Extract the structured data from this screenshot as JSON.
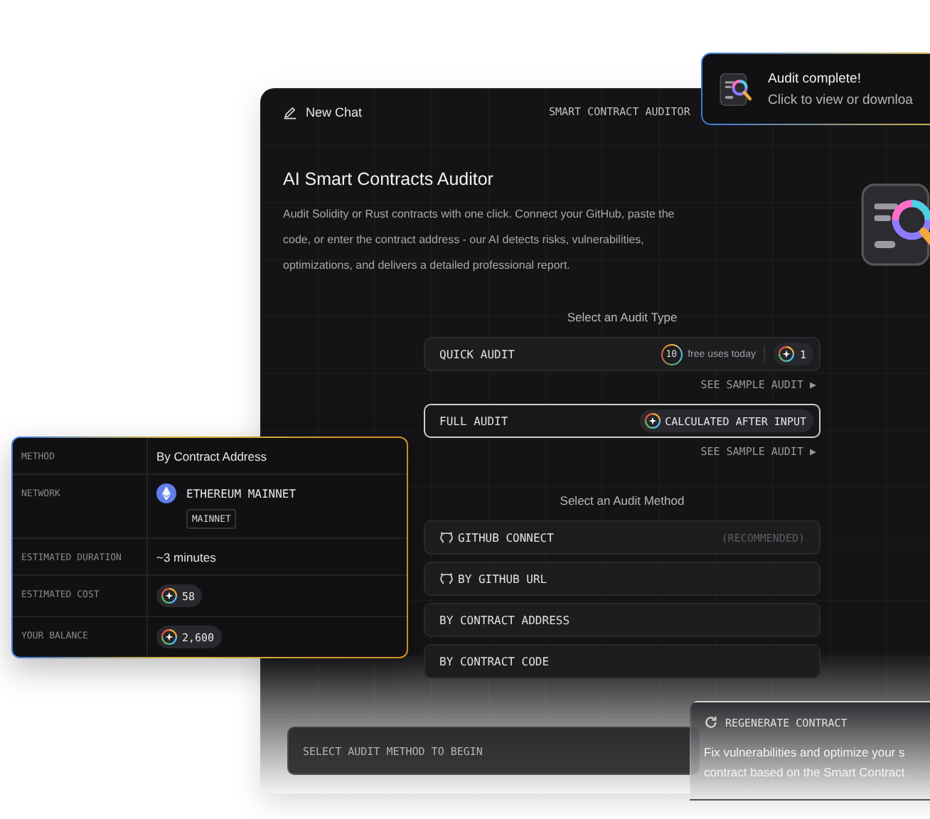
{
  "toast": {
    "title": "Audit complete!",
    "message": "Click to view or downloa"
  },
  "header": {
    "new_chat": "New Chat",
    "title": "SMART CONTRACT AUDITOR"
  },
  "intro": {
    "heading": "AI Smart Contracts Auditor",
    "description": "Audit Solidity or Rust contracts with one click. Connect your GitHub, paste the code, or enter the contract address - our AI detects risks, vulnerabilities, optimizations, and delivers a detailed professional report."
  },
  "audit_types": {
    "heading": "Select an Audit Type",
    "options": [
      {
        "label": "QUICK AUDIT",
        "selected": false,
        "kind": "free",
        "free_count": "10",
        "free_text": "free uses today",
        "cost": "1",
        "sample_link": "SEE SAMPLE AUDIT ▶"
      },
      {
        "label": "FULL AUDIT",
        "selected": true,
        "kind": "calculated",
        "cost": "CALCULATED AFTER INPUT",
        "sample_link": "SEE SAMPLE AUDIT ▶"
      }
    ]
  },
  "audit_methods": {
    "heading": "Select an Audit Method",
    "options": [
      {
        "label": "GITHUB CONNECT",
        "kind": "github",
        "note": "(RECOMMENDED)"
      },
      {
        "label": "BY GITHUB URL",
        "kind": "github"
      },
      {
        "label": "BY CONTRACT ADDRESS",
        "kind": "plain"
      },
      {
        "label": "BY CONTRACT CODE",
        "kind": "plain"
      }
    ]
  },
  "prompt": {
    "placeholder": "SELECT AUDIT METHOD TO BEGIN"
  },
  "summary": {
    "rows": [
      {
        "label": "METHOD",
        "kind": "text",
        "value": "By Contract Address"
      },
      {
        "label": "NETWORK",
        "kind": "network",
        "value": "ETHEREUM MAINNET",
        "tag": "MAINNET"
      },
      {
        "label": "ESTIMATED DURATION",
        "kind": "text",
        "value": "~3 minutes"
      },
      {
        "label": "ESTIMATED COST",
        "kind": "credits",
        "value": "58"
      },
      {
        "label": "YOUR BALANCE",
        "kind": "credits",
        "value": "2,600"
      }
    ]
  },
  "regenerate": {
    "title": "REGENERATE CONTRACT",
    "description_lines": [
      "Fix vulnerabilities and optimize your s",
      "contract based on the Smart Contract"
    ]
  }
}
